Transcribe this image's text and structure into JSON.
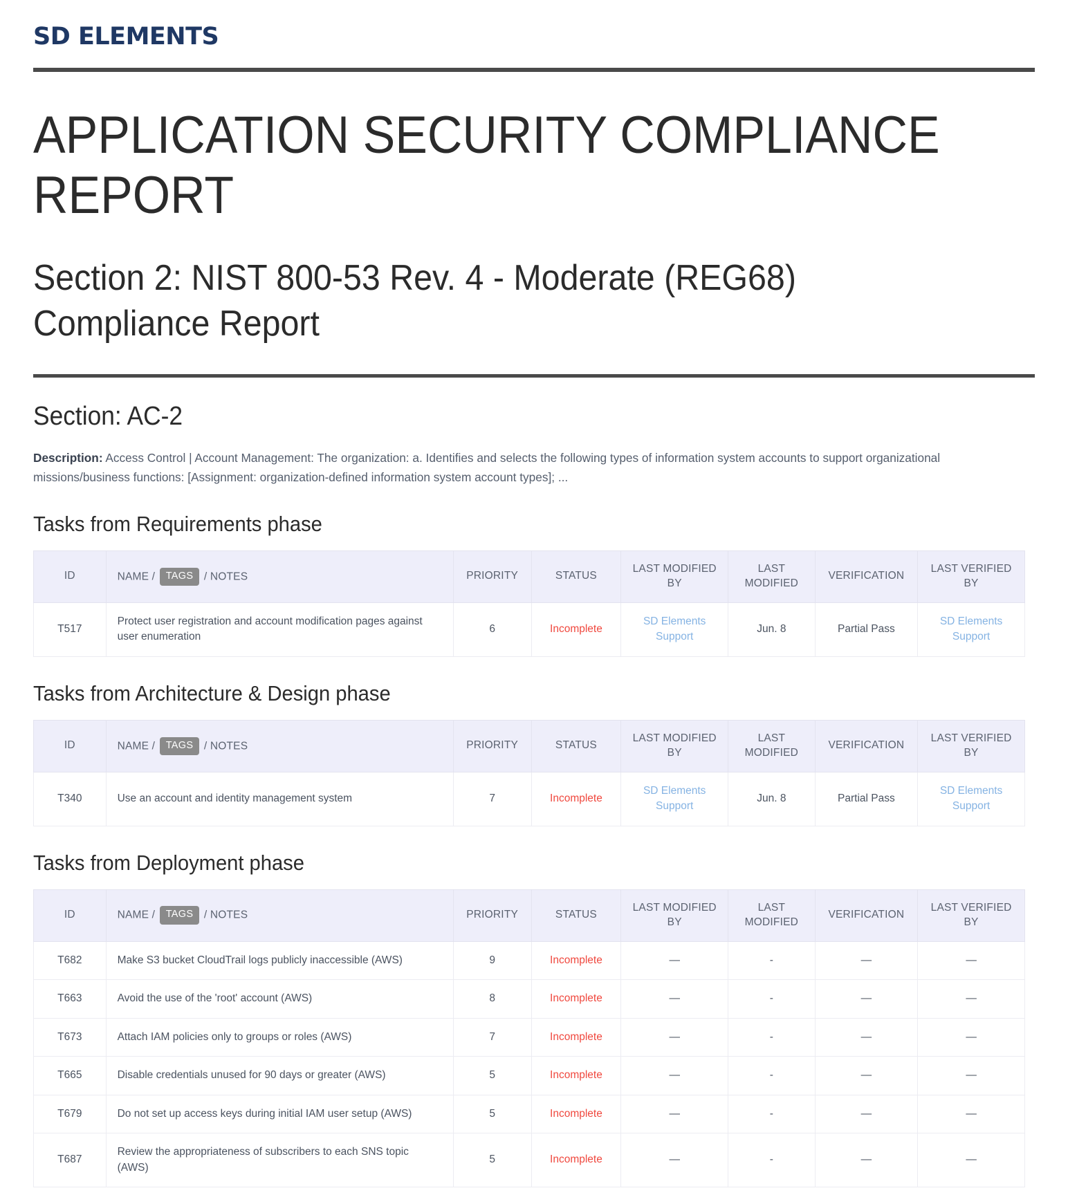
{
  "brand": {
    "name": "SD ELEMENTS"
  },
  "report": {
    "title": "APPLICATION SECURITY COMPLIANCE REPORT",
    "section_heading": "Section 2: NIST 800-53 Rev. 4 - Moderate (REG68) Compliance Report",
    "subsection_heading": "Section: AC-2",
    "description_label": "Description:",
    "description_text": " Access Control | Account Management: The organization: a. Identifies and selects the following types of information system accounts to support organizational missions/business functions: [Assignment: organization-defined information system account types]; ..."
  },
  "colors": {
    "brand": "#1f3864",
    "rule": "#4a4a4a",
    "header_bg": "#eeeefa",
    "status_incomplete": "#f0483e",
    "link": "#85b3e3",
    "tag_badge": "#8a8a8a"
  },
  "table_headers": {
    "id": "ID",
    "name_prefix": "NAME /",
    "tags_badge": "TAGS",
    "name_suffix": "/ NOTES",
    "priority": "PRIORITY",
    "status": "STATUS",
    "last_modified_by": "LAST MODIFIED BY",
    "last_modified": "LAST MODIFIED",
    "verification": "VERIFICATION",
    "last_verified_by": "LAST VERIFIED BY"
  },
  "phases": [
    {
      "title": "Tasks from Requirements phase",
      "rows": [
        {
          "id": "T517",
          "name": "Protect user registration and account modification pages against user enumeration",
          "priority": "6",
          "status": "Incomplete",
          "last_modified_by": "SD Elements Support",
          "last_modified": "Jun. 8",
          "verification": "Partial Pass",
          "last_verified_by": "SD Elements Support"
        }
      ]
    },
    {
      "title": "Tasks from Architecture & Design phase",
      "rows": [
        {
          "id": "T340",
          "name": "Use an account and identity management system",
          "priority": "7",
          "status": "Incomplete",
          "last_modified_by": "SD Elements Support",
          "last_modified": "Jun. 8",
          "verification": "Partial Pass",
          "last_verified_by": "SD Elements Support"
        }
      ]
    },
    {
      "title": "Tasks from Deployment phase",
      "rows": [
        {
          "id": "T682",
          "name": "Make S3 bucket CloudTrail logs publicly inaccessible (AWS)",
          "priority": "9",
          "status": "Incomplete",
          "last_modified_by": "—",
          "last_modified": "-",
          "verification": "—",
          "last_verified_by": "—"
        },
        {
          "id": "T663",
          "name": "Avoid the use of the 'root' account (AWS)",
          "priority": "8",
          "status": "Incomplete",
          "last_modified_by": "—",
          "last_modified": "-",
          "verification": "—",
          "last_verified_by": "—"
        },
        {
          "id": "T673",
          "name": "Attach IAM policies only to groups or roles (AWS)",
          "priority": "7",
          "status": "Incomplete",
          "last_modified_by": "—",
          "last_modified": "-",
          "verification": "—",
          "last_verified_by": "—"
        },
        {
          "id": "T665",
          "name": "Disable credentials unused for 90 days or greater (AWS)",
          "priority": "5",
          "status": "Incomplete",
          "last_modified_by": "—",
          "last_modified": "-",
          "verification": "—",
          "last_verified_by": "—"
        },
        {
          "id": "T679",
          "name": "Do not set up access keys during initial IAM user setup (AWS)",
          "priority": "5",
          "status": "Incomplete",
          "last_modified_by": "—",
          "last_modified": "-",
          "verification": "—",
          "last_verified_by": "—"
        },
        {
          "id": "T687",
          "name": "Review the appropriateness of subscribers to each SNS topic (AWS)",
          "priority": "5",
          "status": "Incomplete",
          "last_modified_by": "—",
          "last_modified": "-",
          "verification": "—",
          "last_verified_by": "—"
        }
      ]
    }
  ]
}
